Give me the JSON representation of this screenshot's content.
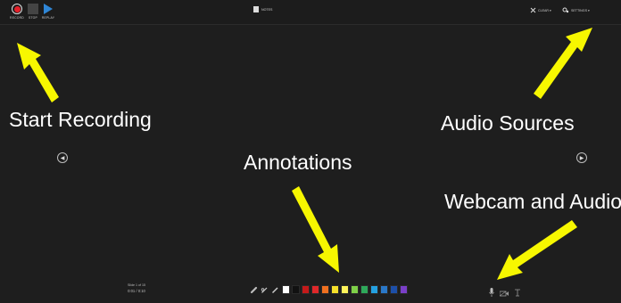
{
  "toolbar": {
    "record_label": "RECORD",
    "stop_label": "STOP",
    "replay_label": "REPLAY",
    "notes_label": "NOTES",
    "clear_label": "CLEAR ▾",
    "settings_label": "SETTINGS ▾"
  },
  "annotations": {
    "start_recording": "Start Recording",
    "annotations": "Annotations",
    "audio_sources": "Audio Sources",
    "webcam_audio": "Webcam and Audio"
  },
  "slide": {
    "label": "Slide 1 of 15",
    "time": "0:01 / 0:10"
  },
  "navigation": {
    "prev_glyph": "◀",
    "next_glyph": "▶"
  },
  "colors": {
    "background": "#1e1e1e",
    "arrow": "#f7f700",
    "record": "#e5202a",
    "replay": "#2f86d6"
  },
  "palette": [
    "#ffffff",
    "#111111",
    "#c41a1a",
    "#e0282a",
    "#f07020",
    "#f6e02a",
    "#fff35a",
    "#7fd048",
    "#2ea85a",
    "#24a0e0",
    "#2a78c8",
    "#1d4fa8",
    "#7a3fc8"
  ]
}
